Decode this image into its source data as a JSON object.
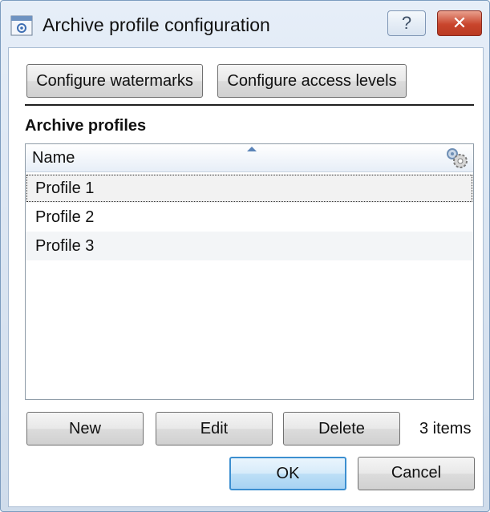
{
  "window": {
    "title": "Archive profile configuration",
    "help_label": "?",
    "close_label": "✕"
  },
  "toolbar": {
    "watermarks_label": "Configure watermarks",
    "access_levels_label": "Configure access levels"
  },
  "profiles": {
    "section_label": "Archive profiles",
    "column_name": "Name",
    "sort_direction": "ascending",
    "items": [
      {
        "name": "Profile 1",
        "focused": true
      },
      {
        "name": "Profile 2"
      },
      {
        "name": "Profile 3"
      }
    ],
    "count_label": "3 items"
  },
  "actions": {
    "new_label": "New",
    "edit_label": "Edit",
    "delete_label": "Delete"
  },
  "footer": {
    "ok_label": "OK",
    "cancel_label": "Cancel"
  },
  "icons": {
    "app": "window-settings-icon",
    "column_settings": "gear-icon",
    "sort": "sort-ascending-icon"
  },
  "colors": {
    "titlebar": "#cfdceb",
    "close": "#c9452c",
    "ok_border": "#3c8fd0",
    "header": "#e7eef7"
  }
}
